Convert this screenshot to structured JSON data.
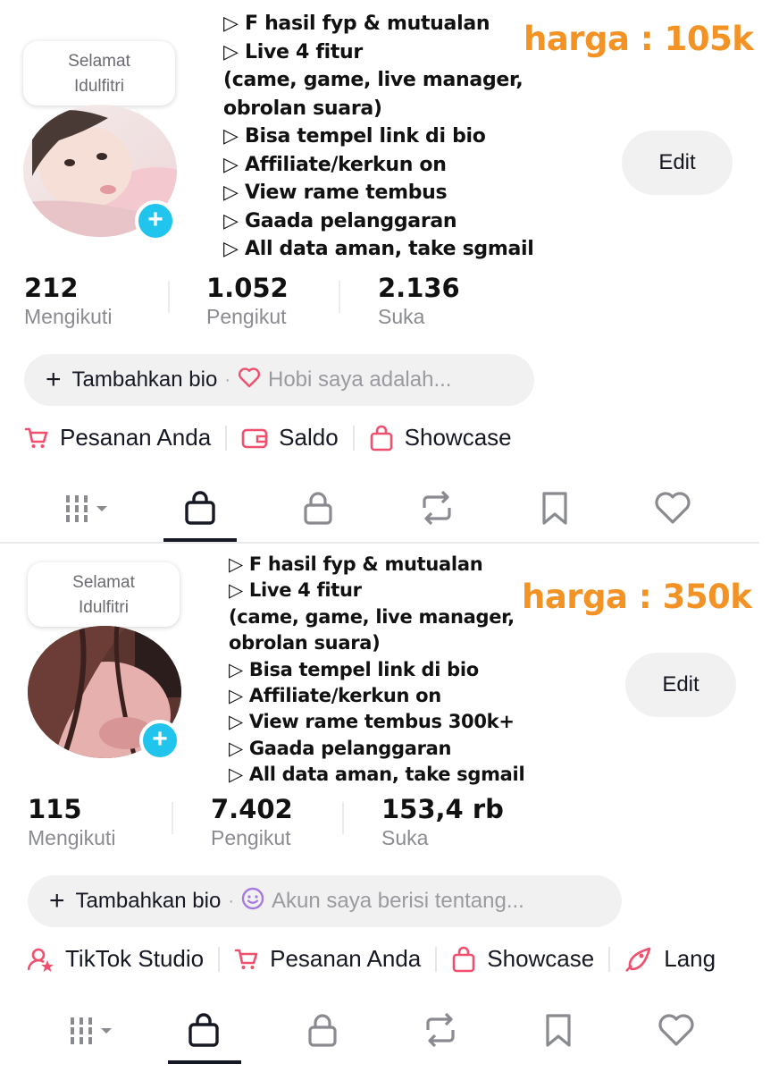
{
  "accounts": [
    {
      "bubble": {
        "line1": "Selamat",
        "line2": "Idulfitri"
      },
      "features": [
        "▷ F hasil fyp & mutualan",
        "▷ Live 4 fitur",
        "(came, game, live manager,",
        "obrolan suara)",
        "▷ Bisa tempel link di bio",
        "▷ Affiliate/kerkun on",
        "▷ View rame tembus",
        "▷ Gaada pelanggaran",
        "▷ All data aman, take sgmail"
      ],
      "price": "harga : 105k",
      "edit_label": "Edit",
      "stats": [
        {
          "value": "212",
          "label": "Mengikuti"
        },
        {
          "value": "1.052",
          "label": "Pengikut"
        },
        {
          "value": "2.136",
          "label": "Suka"
        }
      ],
      "bio": {
        "plus": "+",
        "label": "Tambahkan bio",
        "dot": "·",
        "hint": "Hobi saya adalah..."
      },
      "shortcuts": [
        "Pesanan Anda",
        "Saldo",
        "Showcase"
      ]
    },
    {
      "bubble": {
        "line1": "Selamat",
        "line2": "Idulfitri"
      },
      "features": [
        "▷ F hasil fyp & mutualan",
        "▷ Live 4 fitur",
        "(came, game, live manager,",
        "obrolan suara)",
        "▷ Bisa tempel link di bio",
        "▷ Affiliate/kerkun on",
        "▷ View rame tembus 300k+",
        "▷ Gaada pelanggaran",
        "▷ All data aman, take sgmail"
      ],
      "price": "harga : 350k",
      "edit_label": "Edit",
      "stats": [
        {
          "value": "115",
          "label": "Mengikuti"
        },
        {
          "value": "7.402",
          "label": "Pengikut"
        },
        {
          "value": "153,4 rb",
          "label": "Suka"
        }
      ],
      "bio": {
        "plus": "+",
        "label": "Tambahkan bio",
        "dot": "·",
        "hint": "Akun saya berisi tentang..."
      },
      "shortcuts": [
        "TikTok Studio",
        "Pesanan Anda",
        "Showcase",
        "Lang"
      ]
    }
  ],
  "tabs": [
    "grid-menu-icon",
    "shop-bag-icon",
    "lock-icon",
    "repost-icon",
    "bookmark-icon",
    "heart-icon"
  ],
  "colors": {
    "price": "#f39325",
    "accent_pink": "#fe2c55",
    "plus_badge": "#20c4ec"
  }
}
